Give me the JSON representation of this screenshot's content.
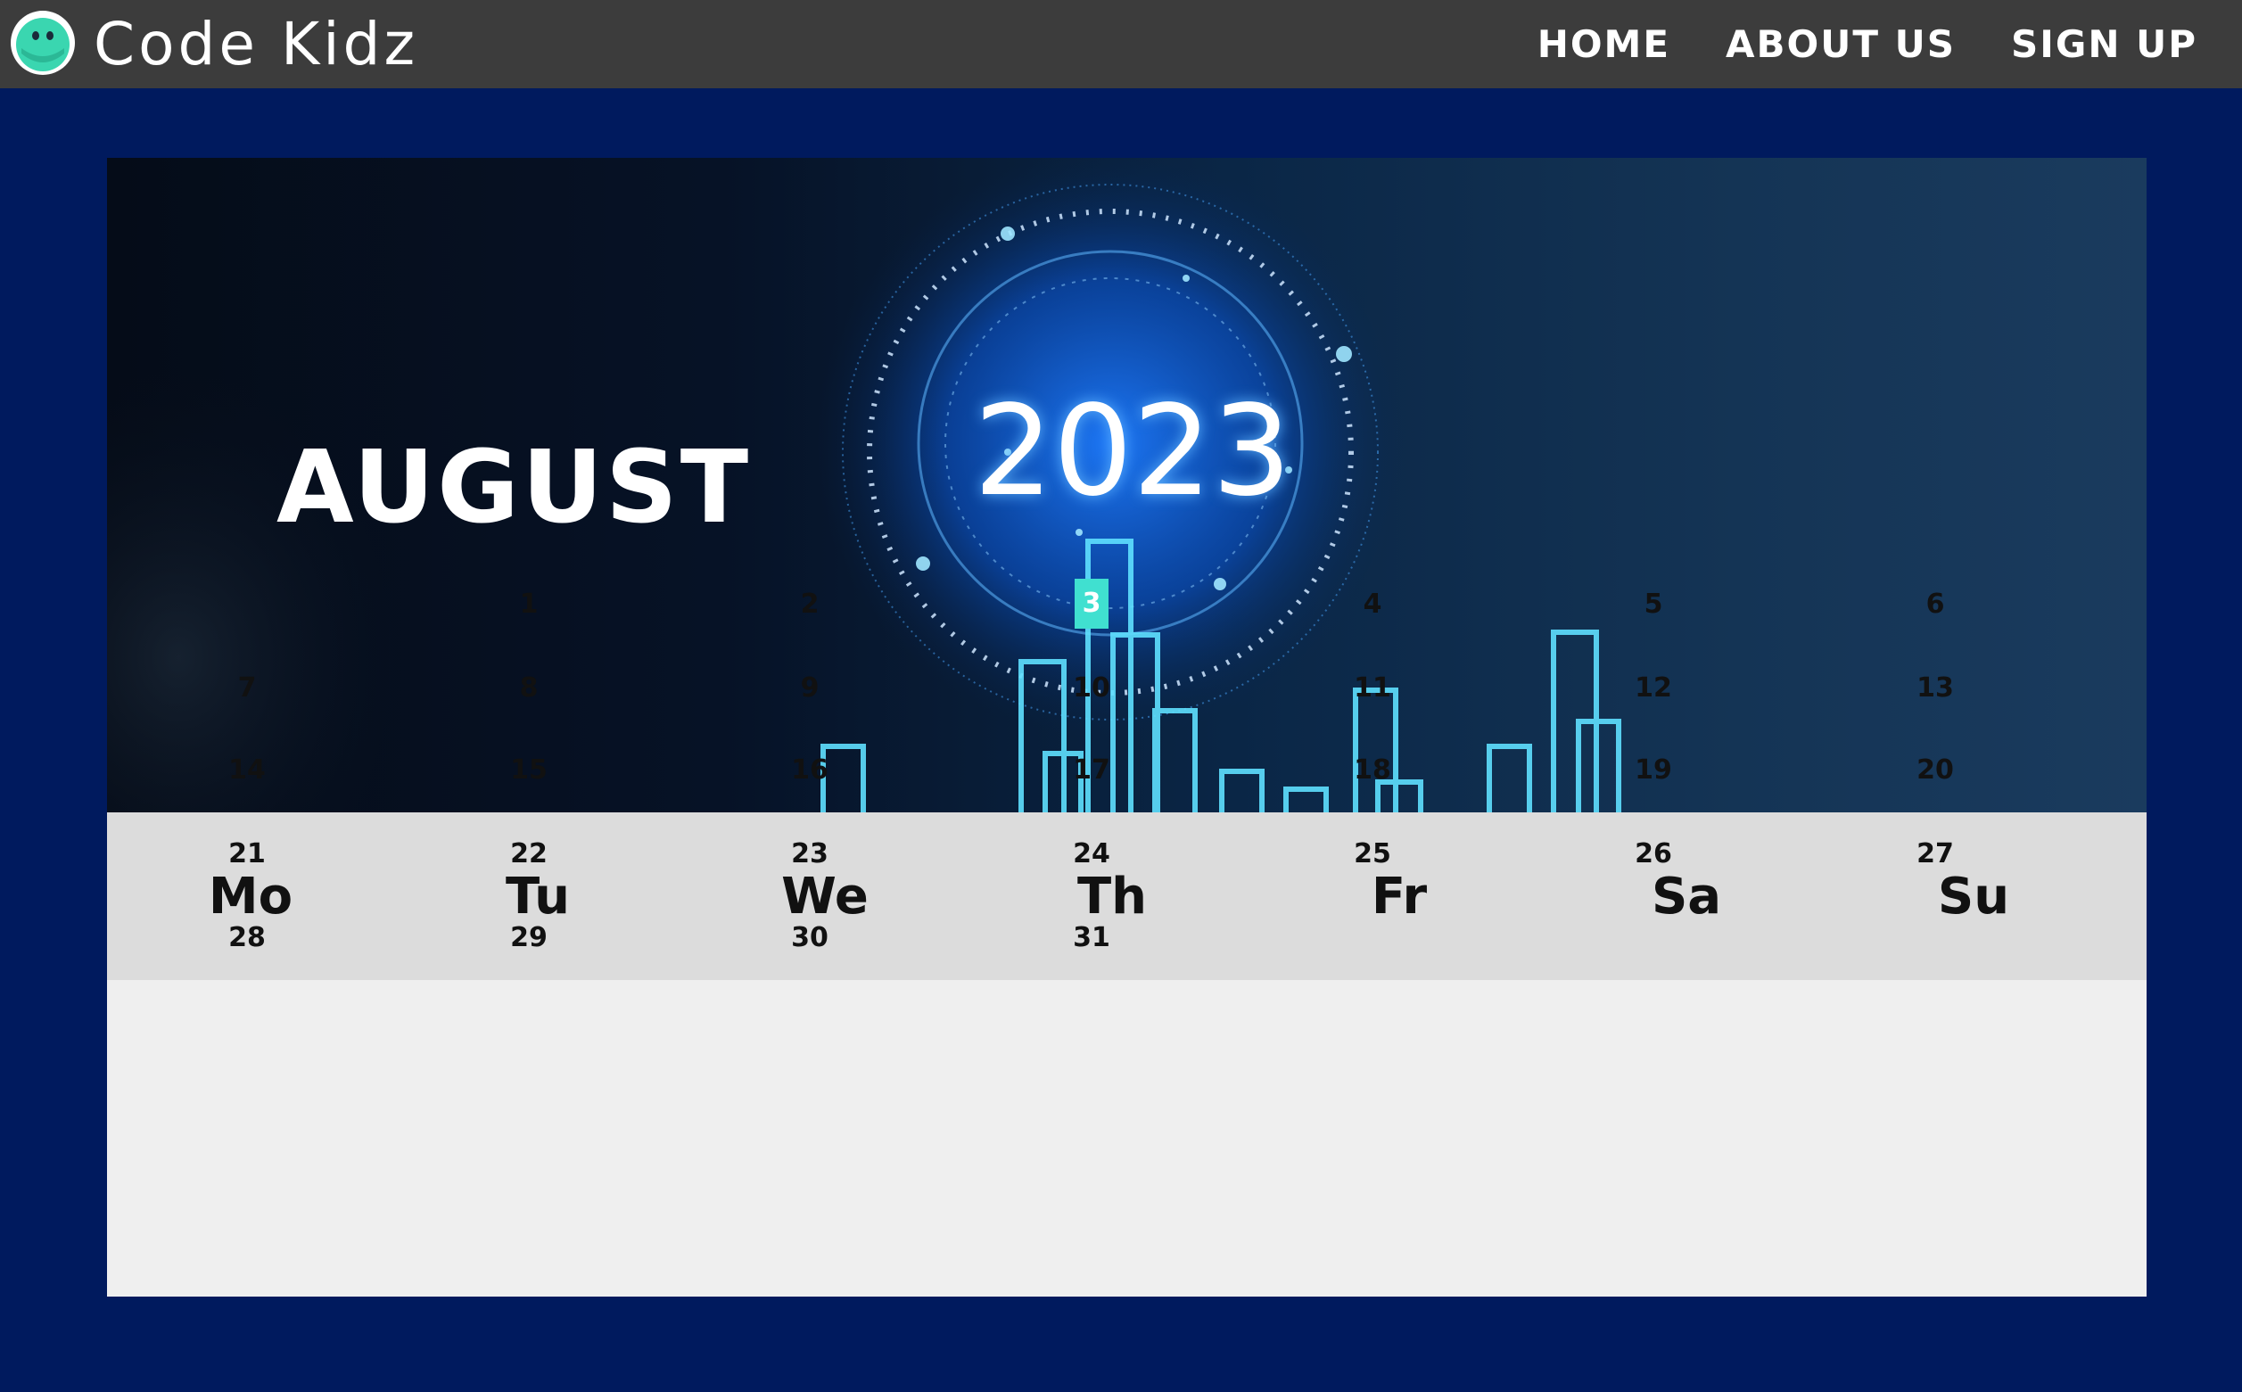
{
  "header": {
    "brand": "Code Kidz",
    "nav": [
      "HOME",
      "ABOUT US",
      "SIGN UP"
    ]
  },
  "banner": {
    "month": "AUGUST",
    "year": "2023"
  },
  "calendar": {
    "weekdays": [
      "Mo",
      "Tu",
      "We",
      "Th",
      "Fr",
      "Sa",
      "Su"
    ],
    "first_weekday_index": 1,
    "days_in_month": 31,
    "today": 3,
    "today_color": "#40e0d0"
  },
  "colors": {
    "page_bg": "#001a5e",
    "header_bg": "#3c3c3c",
    "weekday_bg": "#dcdcdc",
    "days_bg": "#efefef",
    "logo_green": "#3ad6b0"
  }
}
